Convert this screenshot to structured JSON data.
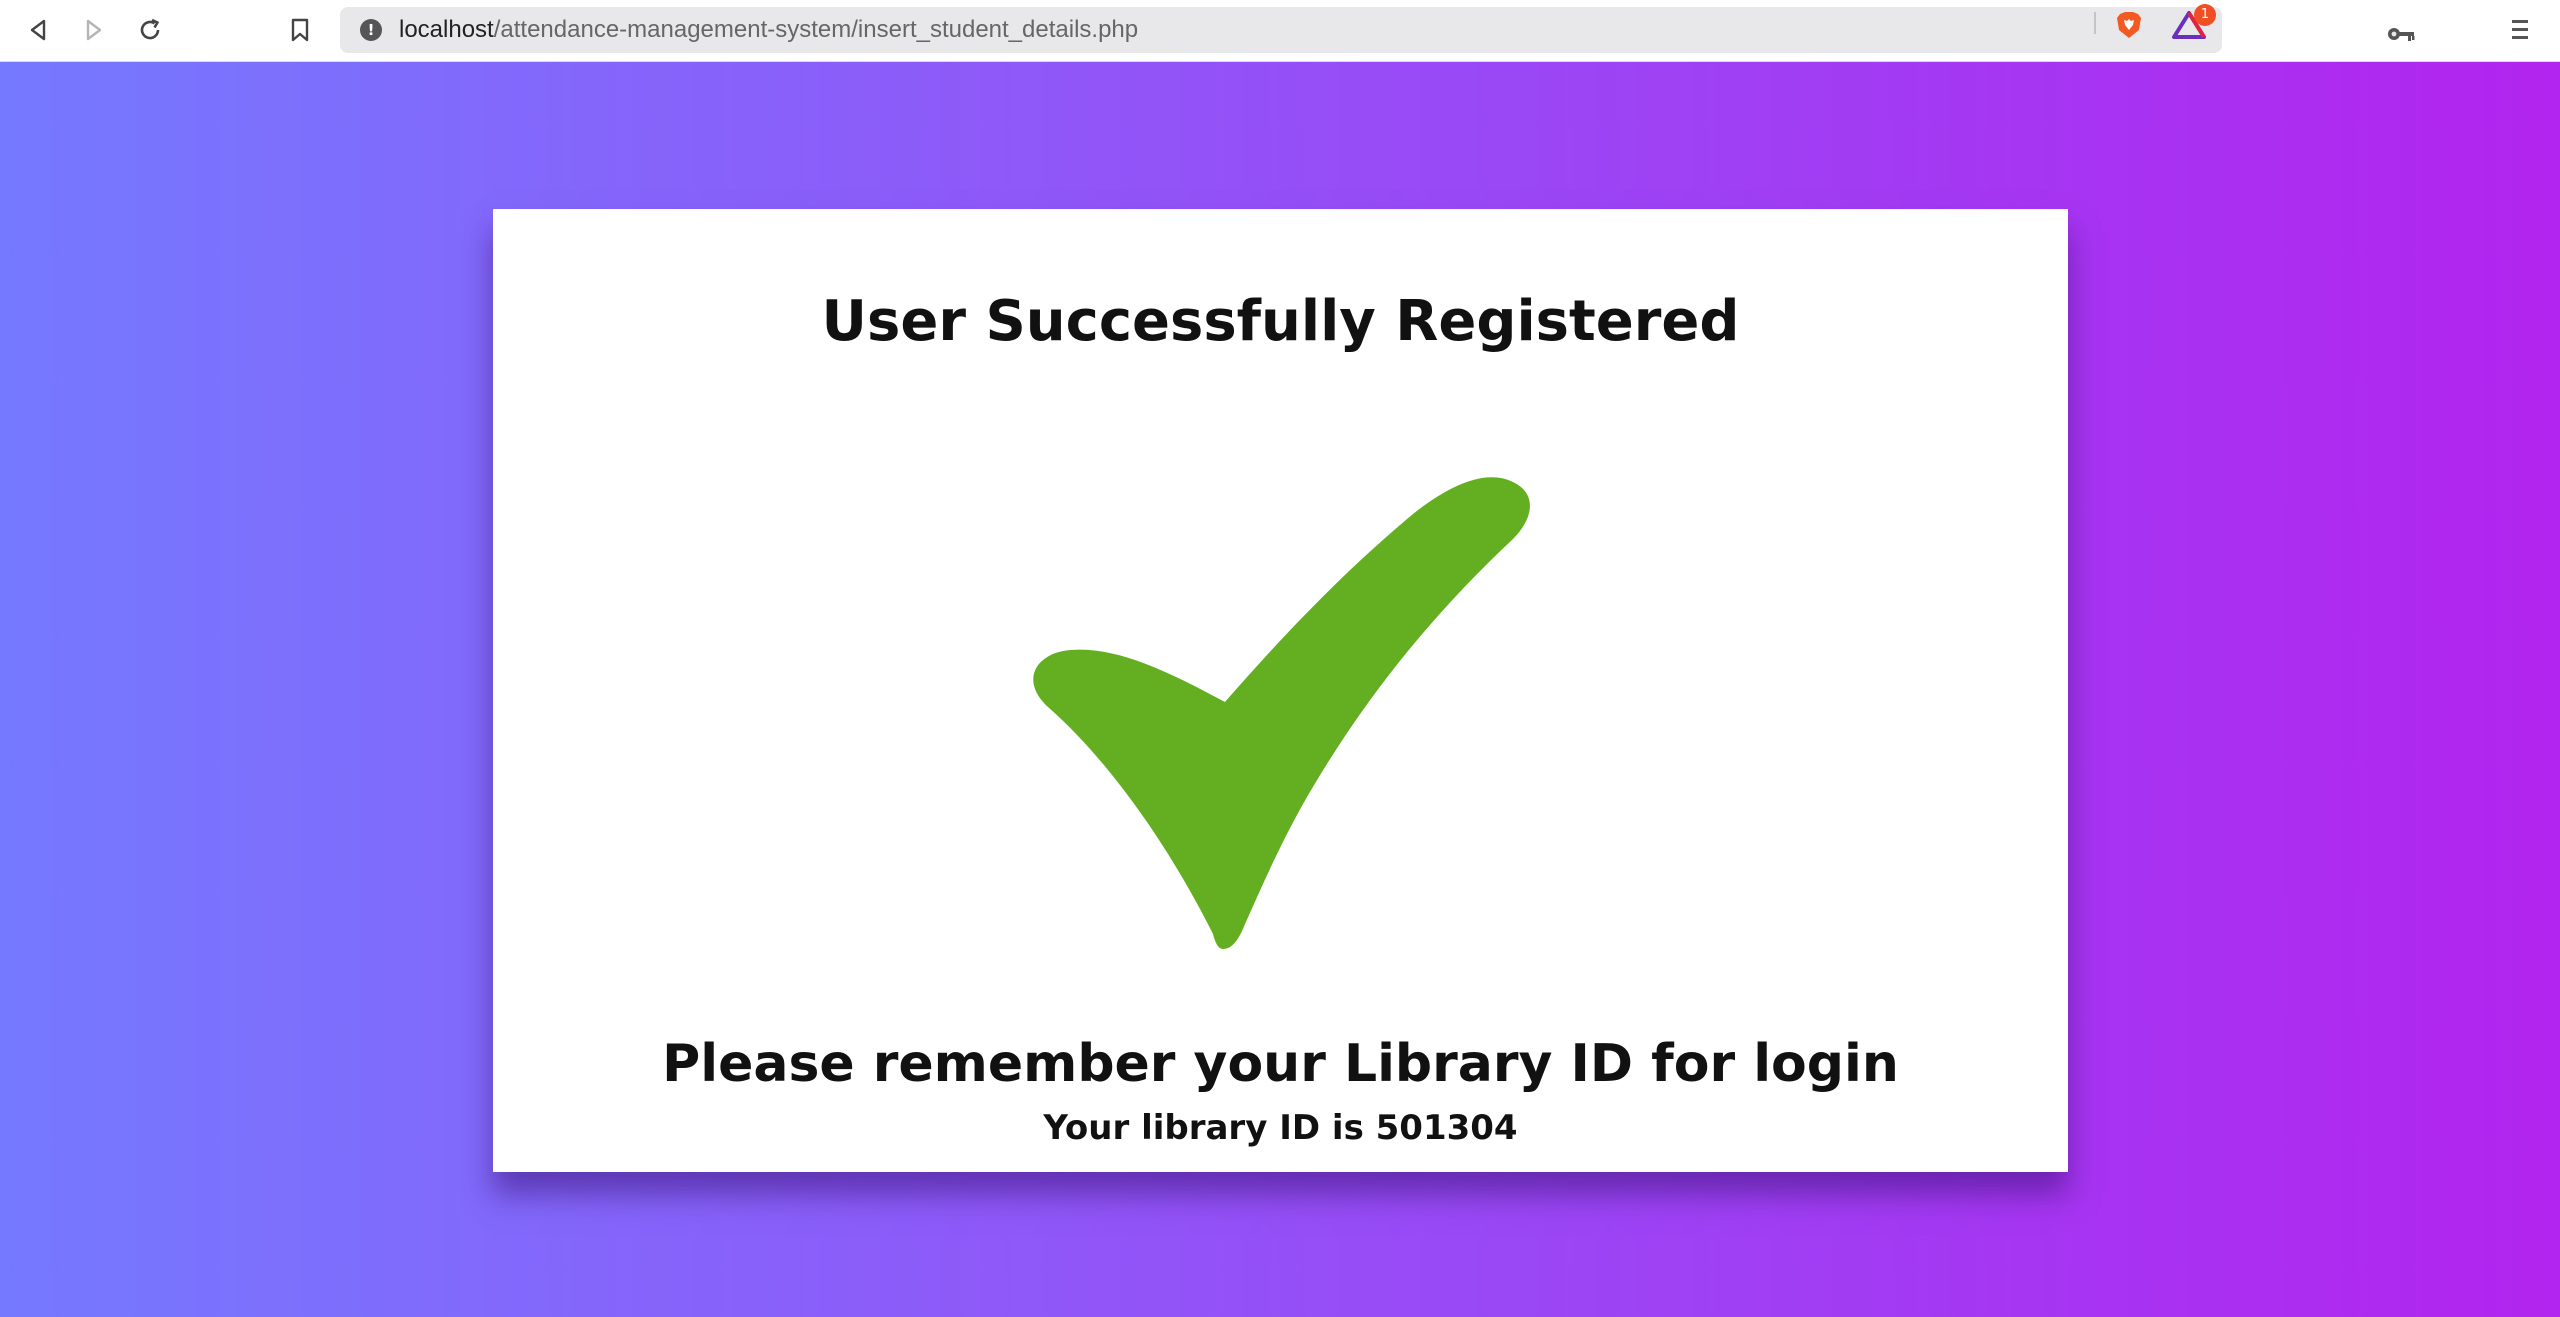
{
  "browser": {
    "url_host": "localhost",
    "url_path": "/attendance-management-system/insert_student_details.php",
    "rewards_badge_count": "1",
    "icons": [
      "back-icon",
      "forward-icon",
      "reload-icon",
      "bookmark-icon",
      "site-info-icon",
      "key-icon",
      "brave-shield-icon",
      "brave-rewards-icon",
      "menu-icon"
    ]
  },
  "page": {
    "title": "User Successfully Registered",
    "message": "Please remember your Library ID for login",
    "library_id_text": "Your library ID is 501304"
  },
  "colors": {
    "gradient_start": "#7579ff",
    "gradient_end": "#b224ef",
    "check_green": "#63af21",
    "card_bg": "#ffffff"
  }
}
